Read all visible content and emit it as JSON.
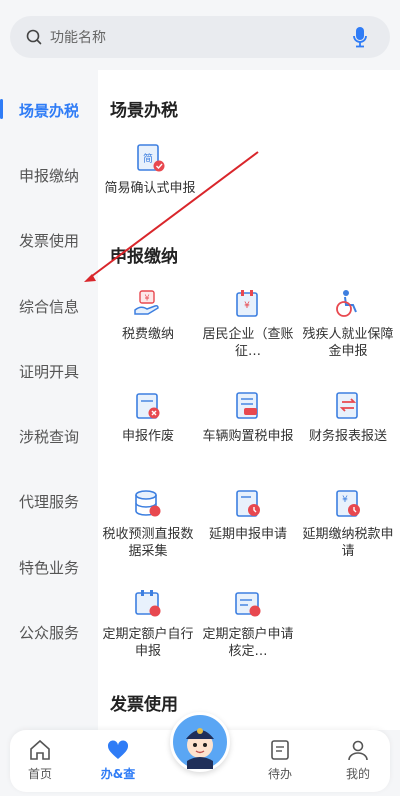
{
  "search": {
    "placeholder": "功能名称",
    "search_icon": "search-icon",
    "mic_icon": "mic-icon"
  },
  "sidebar": {
    "items": [
      {
        "label": "场景办税",
        "active": true
      },
      {
        "label": "申报缴纳",
        "active": false
      },
      {
        "label": "发票使用",
        "active": false
      },
      {
        "label": "综合信息",
        "active": false
      },
      {
        "label": "证明开具",
        "active": false
      },
      {
        "label": "涉税查询",
        "active": false
      },
      {
        "label": "代理服务",
        "active": false
      },
      {
        "label": "特色业务",
        "active": false
      },
      {
        "label": "公众服务",
        "active": false
      }
    ]
  },
  "sections": [
    {
      "title": "场景办税",
      "tiles": [
        {
          "label": "简易确认式申报",
          "icon": "simple-declare-icon"
        }
      ]
    },
    {
      "title": "申报缴纳",
      "tiles": [
        {
          "label": "税费缴纳",
          "icon": "tax-payment-icon"
        },
        {
          "label": "居民企业（查账征…",
          "icon": "resident-enterprise-icon"
        },
        {
          "label": "残疾人就业保障金申报",
          "icon": "disability-icon"
        },
        {
          "label": "申报作废",
          "icon": "declare-void-icon"
        },
        {
          "label": "车辆购置税申报",
          "icon": "vehicle-tax-icon"
        },
        {
          "label": "财务报表报送",
          "icon": "financial-report-icon"
        },
        {
          "label": "税收预测直报数据采集",
          "icon": "tax-forecast-icon"
        },
        {
          "label": "延期申报申请",
          "icon": "delay-declare-icon"
        },
        {
          "label": "延期缴纳税款申请",
          "icon": "delay-payment-icon"
        },
        {
          "label": "定期定额户自行申报",
          "icon": "fixed-quota-self-icon"
        },
        {
          "label": "定期定额户申请核定…",
          "icon": "fixed-quota-apply-icon"
        }
      ]
    },
    {
      "title": "发票使用",
      "tiles": []
    }
  ],
  "tabbar": {
    "items": [
      {
        "label": "首页",
        "icon": "home-icon",
        "active": false
      },
      {
        "label": "办&查",
        "icon": "heart-icon",
        "active": true
      },
      {
        "label": "待办",
        "icon": "todo-icon",
        "active": false
      },
      {
        "label": "我的",
        "icon": "user-icon",
        "active": false
      }
    ],
    "center_icon": "assistant-avatar-icon"
  },
  "colors": {
    "accent": "#2f7cf6",
    "icon_blue": "#3d7fe0",
    "icon_red": "#e8484f",
    "arrow": "#d9262b"
  }
}
